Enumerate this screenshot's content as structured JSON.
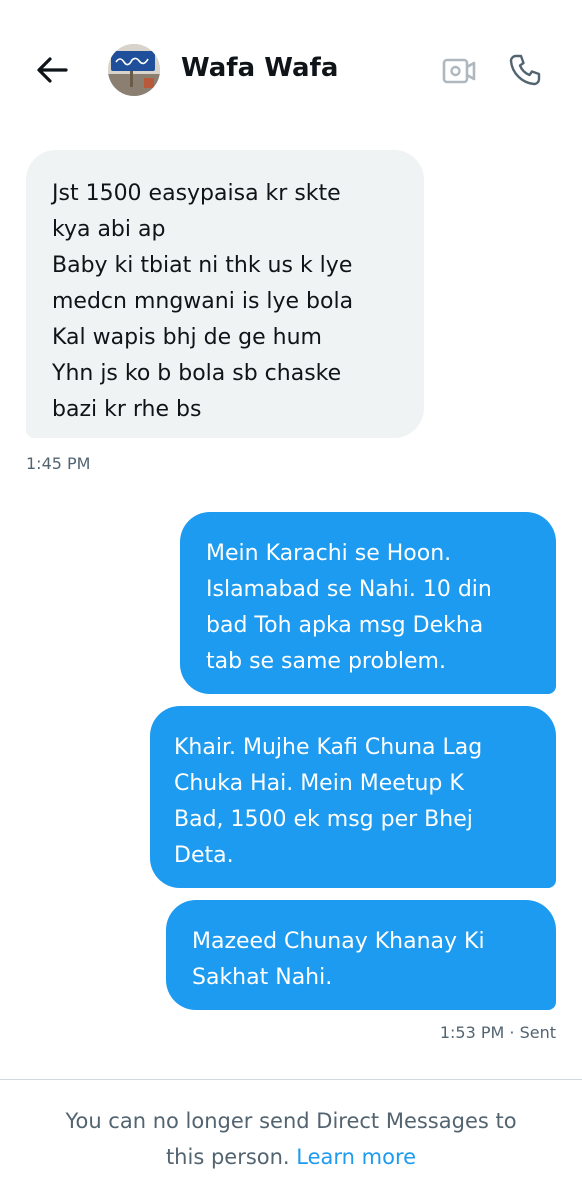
{
  "header": {
    "contact_name": "Wafa Wafa",
    "back_icon": "arrow-left-icon",
    "video_icon": "video-camera-icon",
    "phone_icon": "phone-icon"
  },
  "messages": [
    {
      "direction": "received",
      "lines": [
        "Jst 1500 easypaisa kr skte",
        "kya  abi ap",
        "Baby ki tbiat ni thk us k lye",
        "medcn mngwani is lye bola",
        "Kal wapis bhj de ge hum",
        "Yhn js ko b bola sb chaske",
        "bazi kr rhe bs"
      ]
    },
    {
      "direction": "sent",
      "lines": [
        "Mein Karachi se Hoon.",
        "Islamabad se Nahi. 10 din",
        "bad Toh apka msg Dekha",
        "tab se same problem."
      ]
    },
    {
      "direction": "sent",
      "lines": [
        "Khair. Mujhe Kafi Chuna Lag",
        "Chuka Hai. Mein Meetup K",
        "Bad, 1500 ek msg per Bhej",
        "Deta."
      ]
    },
    {
      "direction": "sent",
      "lines": [
        "Mazeed Chunay Khanay Ki",
        "Sakhat Nahi."
      ]
    }
  ],
  "timestamps": {
    "received": "1:45 PM",
    "sent": "1:53 PM · Sent"
  },
  "footer": {
    "notice_line1": "You can no longer send Direct Messages to",
    "notice_line2": "this person. ",
    "learn_more": "Learn more"
  },
  "colors": {
    "accent": "#1d9bf0",
    "received_bubble": "#eff3f4",
    "text_primary": "#0f1419",
    "text_secondary": "#536471"
  }
}
